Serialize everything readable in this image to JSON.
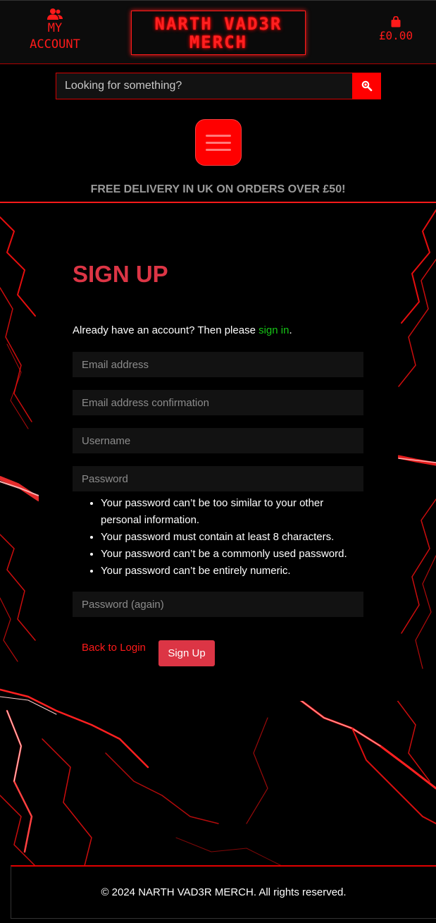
{
  "header": {
    "account_label_line1": "MY",
    "account_label_line2": "ACCOUNT",
    "logo_line1": "NARTH VAD3R",
    "logo_line2": "MERCH",
    "basket_total": "£0.00"
  },
  "search": {
    "placeholder": "Looking for something?",
    "value": ""
  },
  "banner": {
    "delivery_text": "FREE DELIVERY IN UK ON ORDERS OVER £50!"
  },
  "signup": {
    "title": "SIGN UP",
    "already_prefix": "Already have an account? Then please ",
    "sign_in_link": "sign in",
    "already_suffix": ".",
    "email_placeholder": "Email address",
    "email_confirm_placeholder": "Email address confirmation",
    "username_placeholder": "Username",
    "password_placeholder": "Password",
    "password_help": [
      "Your password can’t be too similar to your other personal information.",
      "Your password must contain at least 8 characters.",
      "Your password can’t be a commonly used password.",
      "Your password can’t be entirely numeric."
    ],
    "password_again_placeholder": "Password (again)",
    "back_link": "Back to Login",
    "submit_label": "Sign Up"
  },
  "footer": {
    "copyright": "© 2024 NARTH VAD3R MERCH. All rights reserved."
  },
  "colors": {
    "accent": "#ff0000",
    "title": "#dc3545",
    "link_green": "#16c516",
    "background": "#000000"
  },
  "icons": {
    "account": "users-icon",
    "basket": "shopping-bag-icon",
    "search": "search-icon",
    "menu": "hamburger-menu-icon"
  }
}
